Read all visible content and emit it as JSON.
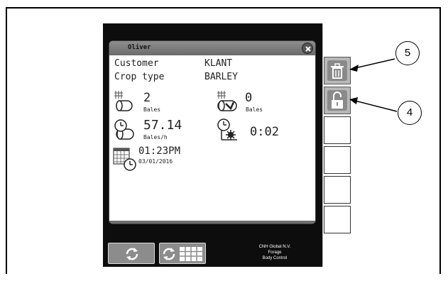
{
  "dialog": {
    "title": "Oliver",
    "customer_label": "Customer",
    "customer_value": "KLANT",
    "crop_label": "Crop type",
    "crop_value": "BARLEY",
    "bales_count": "2",
    "bales_unit": "Bales",
    "bales_count2": "0",
    "bales_unit2": "Bales",
    "rate_value": "57.14",
    "rate_unit": "Bales/h",
    "duration_value": "0:02",
    "time_value": "01:23PM",
    "date_value": "03/01/2016"
  },
  "footer": {
    "brand_line1": "CNH Global N.V.",
    "brand_line2": "Forage",
    "brand_line3": "Body Control"
  },
  "callouts": {
    "delete": "5",
    "unlock": "4"
  },
  "icons": {
    "close": "close-icon",
    "delete": "trash-icon",
    "unlock": "unlock-icon",
    "reset": "recycle-icon",
    "reset_grid": "recycle-grid-icon"
  }
}
